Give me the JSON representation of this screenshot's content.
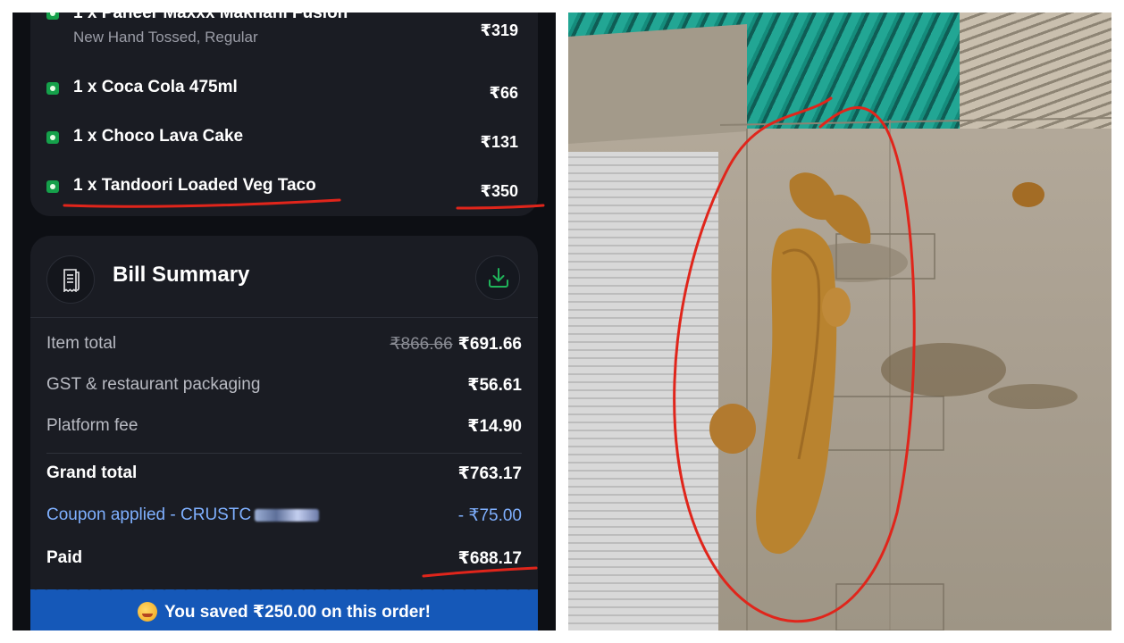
{
  "order_items": [
    {
      "name": "1 x Paneer Maxxx Makhani Fusion",
      "sub": "New Hand Tossed, Regular",
      "price": "₹319"
    },
    {
      "name": "1 x Coca Cola 475ml",
      "sub": "",
      "price": "₹66"
    },
    {
      "name": "1 x Choco Lava Cake",
      "sub": "",
      "price": "₹131"
    },
    {
      "name": "1 x Tandoori Loaded Veg Taco",
      "sub": "",
      "price": "₹350"
    }
  ],
  "bill": {
    "title": "Bill Summary",
    "item_total_label": "Item total",
    "item_total_original": "₹866.66",
    "item_total_value": "₹691.66",
    "gst_label": "GST & restaurant packaging",
    "gst_value": "₹56.61",
    "platform_label": "Platform fee",
    "platform_value": "₹14.90",
    "grand_label": "Grand total",
    "grand_value": "₹763.17",
    "coupon_label": "Coupon applied - CRUSTC",
    "coupon_value": "- ₹75.00",
    "paid_label": "Paid",
    "paid_value": "₹688.17"
  },
  "savings_text": "You saved ₹250.00 on this order!",
  "icons": {
    "veg": "veg-indicator-icon",
    "receipt": "receipt-icon",
    "download": "download-icon",
    "savings": "party-face-icon"
  },
  "colors": {
    "app_bg": "#0d0f14",
    "card_bg": "#1a1c23",
    "veg_green": "#15a04a",
    "coupon_blue": "#7fb0ff",
    "savings_banner": "#1558b8",
    "annotation_red": "#e0251b"
  }
}
